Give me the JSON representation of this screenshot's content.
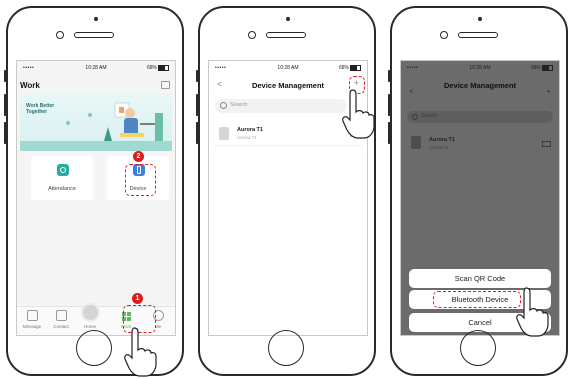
{
  "status": {
    "signal": "•••••",
    "time": "10:28 AM",
    "battery": "68%"
  },
  "screen1": {
    "title": "Work",
    "banner_text": "Work Better Together",
    "tiles": [
      {
        "label": "Attendance",
        "icon": "attendance-icon",
        "color": "#27ae9b"
      },
      {
        "label": "Device",
        "icon": "device-icon",
        "color": "#3a7ee6"
      }
    ],
    "nav": [
      {
        "label": "Message",
        "icon": "message-icon"
      },
      {
        "label": "Contact",
        "icon": "contact-icon"
      },
      {
        "label": "Home",
        "icon": "home-icon"
      },
      {
        "label": "Work",
        "icon": "work-icon",
        "active": true
      },
      {
        "label": "Me",
        "icon": "me-icon"
      }
    ],
    "steps": [
      "1",
      "2"
    ]
  },
  "screen2": {
    "title": "Device Management",
    "back": "<",
    "add": "+",
    "search_placeholder": "Search",
    "devices": [
      {
        "name": "Aurora T1",
        "sub": "Aurora T1"
      }
    ]
  },
  "screen3": {
    "title": "Device Management",
    "back": "<",
    "add": "+",
    "search_placeholder": "Search",
    "devices": [
      {
        "name": "Aurora T1",
        "sub": "Aurora T1"
      }
    ],
    "sheet": {
      "scan": "Scan QR Code",
      "bluetooth": "Bluetooth Device",
      "cancel": "Cancel"
    }
  },
  "colors": {
    "highlight": "#e02020",
    "accent_green": "#5cb85c",
    "dim_overlay": "#6b6b6b"
  }
}
